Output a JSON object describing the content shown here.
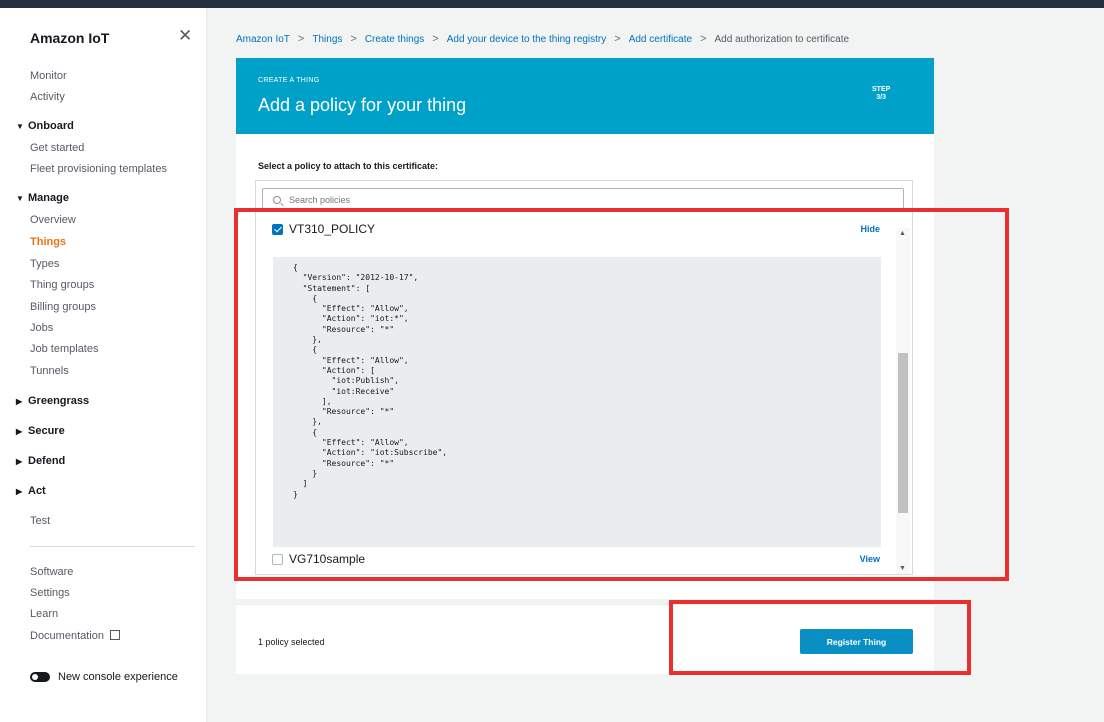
{
  "sidebar": {
    "title": "Amazon IoT",
    "close_label": "✕",
    "items": {
      "monitor": "Monitor",
      "activity": "Activity",
      "onboard": "Onboard",
      "get_started": "Get started",
      "fleet": "Fleet provisioning templates",
      "manage": "Manage",
      "overview": "Overview",
      "things": "Things",
      "types": "Types",
      "thing_groups": "Thing groups",
      "billing_groups": "Billing groups",
      "jobs": "Jobs",
      "job_templates": "Job templates",
      "tunnels": "Tunnels",
      "greengrass": "Greengrass",
      "secure": "Secure",
      "defend": "Defend",
      "act": "Act",
      "test": "Test",
      "software": "Software",
      "settings": "Settings",
      "learn": "Learn",
      "documentation": "Documentation"
    },
    "toggle_label": "New console experience"
  },
  "breadcrumb": {
    "items": [
      "Amazon IoT",
      "Things",
      "Create things",
      "Add your device to the thing registry",
      "Add certificate"
    ],
    "current": "Add authorization to certificate",
    "separator": ">"
  },
  "banner": {
    "kicker": "CREATE A THING",
    "title": "Add a policy for your thing",
    "step_label": "STEP",
    "step_value": "3/3"
  },
  "policy_panel": {
    "label": "Select a policy to attach to this certificate:",
    "search_placeholder": "Search policies",
    "policies": [
      {
        "name": "VT310_POLICY",
        "checked": true,
        "action": "Hide"
      },
      {
        "name": "VG710sample",
        "checked": false,
        "action": "View"
      }
    ],
    "document": "{\n  \"Version\": \"2012-10-17\",\n  \"Statement\": [\n    {\n      \"Effect\": \"Allow\",\n      \"Action\": \"iot:*\",\n      \"Resource\": \"*\"\n    },\n    {\n      \"Effect\": \"Allow\",\n      \"Action\": [\n        \"iot:Publish\",\n        \"iot:Receive\"\n      ],\n      \"Resource\": \"*\"\n    },\n    {\n      \"Effect\": \"Allow\",\n      \"Action\": \"iot:Subscribe\",\n      \"Resource\": \"*\"\n    }\n  ]\n}"
  },
  "footer": {
    "status": "1 policy selected",
    "register_label": "Register Thing"
  },
  "colors": {
    "accent": "#00a1c9",
    "link": "#0073bb",
    "active_nav": "#ec7211",
    "highlight": "#e8312f"
  }
}
